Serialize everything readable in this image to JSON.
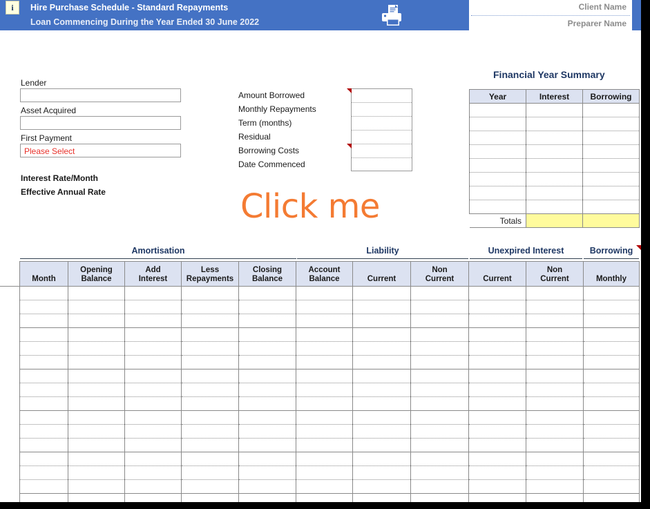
{
  "header": {
    "info_icon": "i",
    "title": "Hire Purchase Schedule - Standard Repayments",
    "subtitle": "Loan Commencing During the Year Ended 30 June 2022",
    "print_icon": "printer-icon",
    "client_name": "Client Name",
    "preparer_name": "Preparer Name",
    "band_color": "#4472C4"
  },
  "left_panel": {
    "lender_label": "Lender",
    "lender_value": "",
    "lender_placeholder": "",
    "asset_label": "Asset Acquired",
    "asset_value": "",
    "asset_placeholder": "",
    "first_payment_label": "First Payment",
    "first_payment_value": "Please Select",
    "first_payment_color": "#E8312A",
    "interest_rate_label": "Interest Rate/Month",
    "interest_rate_value": "",
    "effective_rate_label": "Effective Annual Rate",
    "effective_rate_value": ""
  },
  "mid_panel": {
    "rows": [
      {
        "label": "Amount Borrowed",
        "value": "",
        "comment": true
      },
      {
        "label": "Monthly Repayments",
        "value": "",
        "comment": false
      },
      {
        "label": "Term (months)",
        "value": "",
        "comment": false
      },
      {
        "label": "Residual",
        "value": "",
        "comment": false
      },
      {
        "label": "Borrowing Costs",
        "value": "",
        "comment": true
      },
      {
        "label": "Date Commenced",
        "value": "",
        "comment": false
      }
    ],
    "click_me": "Click me",
    "click_me_color": "#F47B33"
  },
  "fy_summary": {
    "title": "Financial Year Summary",
    "columns": [
      "Year",
      "Interest",
      "Borrowing"
    ],
    "rows": [
      [
        "",
        "",
        ""
      ],
      [
        "",
        "",
        ""
      ],
      [
        "",
        "",
        ""
      ],
      [
        "",
        "",
        ""
      ],
      [
        "",
        "",
        ""
      ],
      [
        "",
        "",
        ""
      ],
      [
        "",
        "",
        ""
      ],
      [
        "",
        "",
        ""
      ]
    ],
    "totals_label": "Totals",
    "totals": [
      "",
      ""
    ],
    "totals_highlight": "#FFFB9D",
    "header_fill": "#DCE2F1"
  },
  "main_table": {
    "sections": [
      {
        "label": "Amortisation",
        "span": 5
      },
      {
        "label": "Liability",
        "span": 3
      },
      {
        "label": "Unexpired Interest",
        "span": 2
      },
      {
        "label": "Borrowing",
        "span": 1,
        "comment": true
      }
    ],
    "columns": [
      {
        "top": "",
        "bottom": "Month"
      },
      {
        "top": "Opening",
        "bottom": "Balance"
      },
      {
        "top": "Add",
        "bottom": "Interest"
      },
      {
        "top": "Less",
        "bottom": "Repayments"
      },
      {
        "top": "Closing",
        "bottom": "Balance"
      },
      {
        "top": "Account",
        "bottom": "Balance"
      },
      {
        "top": "",
        "bottom": "Current"
      },
      {
        "top": "Non",
        "bottom": "Current"
      },
      {
        "top": "",
        "bottom": "Current"
      },
      {
        "top": "Non",
        "bottom": "Current"
      },
      {
        "top": "",
        "bottom": "Monthly"
      }
    ],
    "row_count": 16,
    "band_size": 3,
    "header_fill": "#DCE2F1"
  }
}
